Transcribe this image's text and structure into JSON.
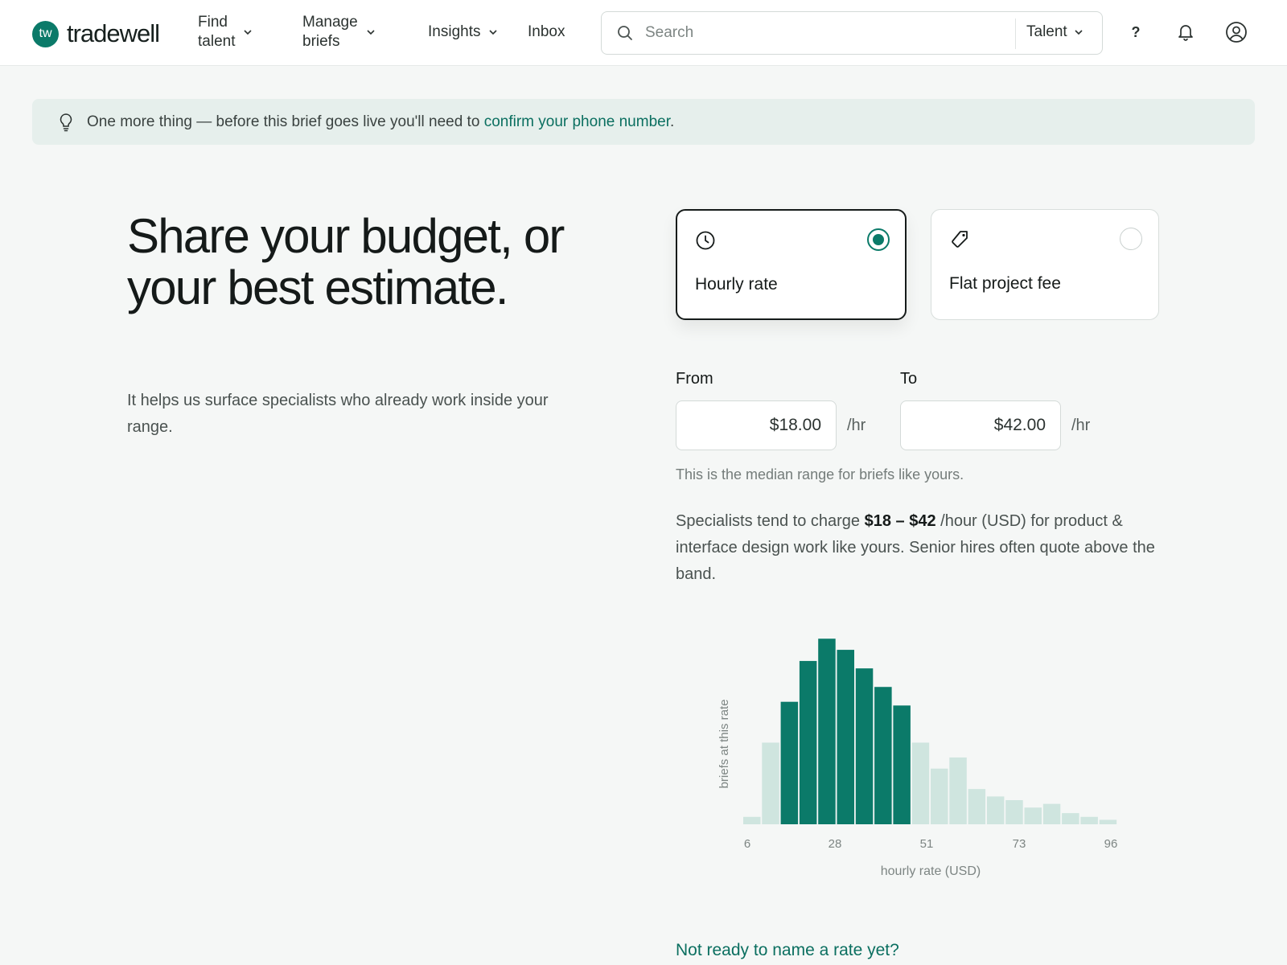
{
  "brand": {
    "mark": "tw",
    "name": "tradewell"
  },
  "nav": {
    "find_talent": [
      "Find",
      "talent"
    ],
    "manage_briefs": [
      "Manage",
      "briefs"
    ],
    "insights": "Insights",
    "inbox": "Inbox"
  },
  "search": {
    "placeholder": "Search",
    "scope": "Talent"
  },
  "header_icons": {
    "help": "?"
  },
  "banner": {
    "text": "One more thing — before this brief goes live you'll need to ",
    "link": "confirm your phone number",
    "suffix": "."
  },
  "hero": {
    "title": "Share your budget, or your best estimate.",
    "subtitle": "It helps us surface specialists who already work inside your range."
  },
  "rate_types": {
    "hourly": {
      "label": "Hourly rate",
      "selected": true,
      "icon": "clock-icon"
    },
    "flat": {
      "label": "Flat project fee",
      "selected": false,
      "icon": "tag-icon"
    }
  },
  "range": {
    "from_label": "From",
    "to_label": "To",
    "from_value": "$18.00",
    "to_value": "$42.00",
    "unit": "/hr",
    "hint": "This is the median range for briefs like yours."
  },
  "description": {
    "pre": "Specialists tend to charge ",
    "range": "$18 – $42",
    "post": " /hour (USD) for product & interface design work like yours. Senior hires often quote above the band."
  },
  "chart_data": {
    "type": "bar",
    "ylabel": "briefs at this rate",
    "xlabel": "hourly rate (USD)",
    "x_ticks": [
      "6",
      "28",
      "51",
      "73",
      "96"
    ],
    "highlight_range": [
      18,
      42
    ],
    "values": [
      2,
      22,
      33,
      44,
      50,
      47,
      42,
      37,
      32,
      22,
      15,
      18,
      9.5,
      7.5,
      6.5,
      4.5,
      5.5,
      3,
      2,
      1.2
    ],
    "highlight_indices": [
      2,
      3,
      4,
      5,
      6,
      7,
      8
    ],
    "ylim": [
      0,
      52
    ],
    "colors": {
      "highlight": "#0b7a69",
      "base": "#cfe5df",
      "axis_text": "#7d8583"
    }
  },
  "cta": "Not ready to name a rate yet?"
}
